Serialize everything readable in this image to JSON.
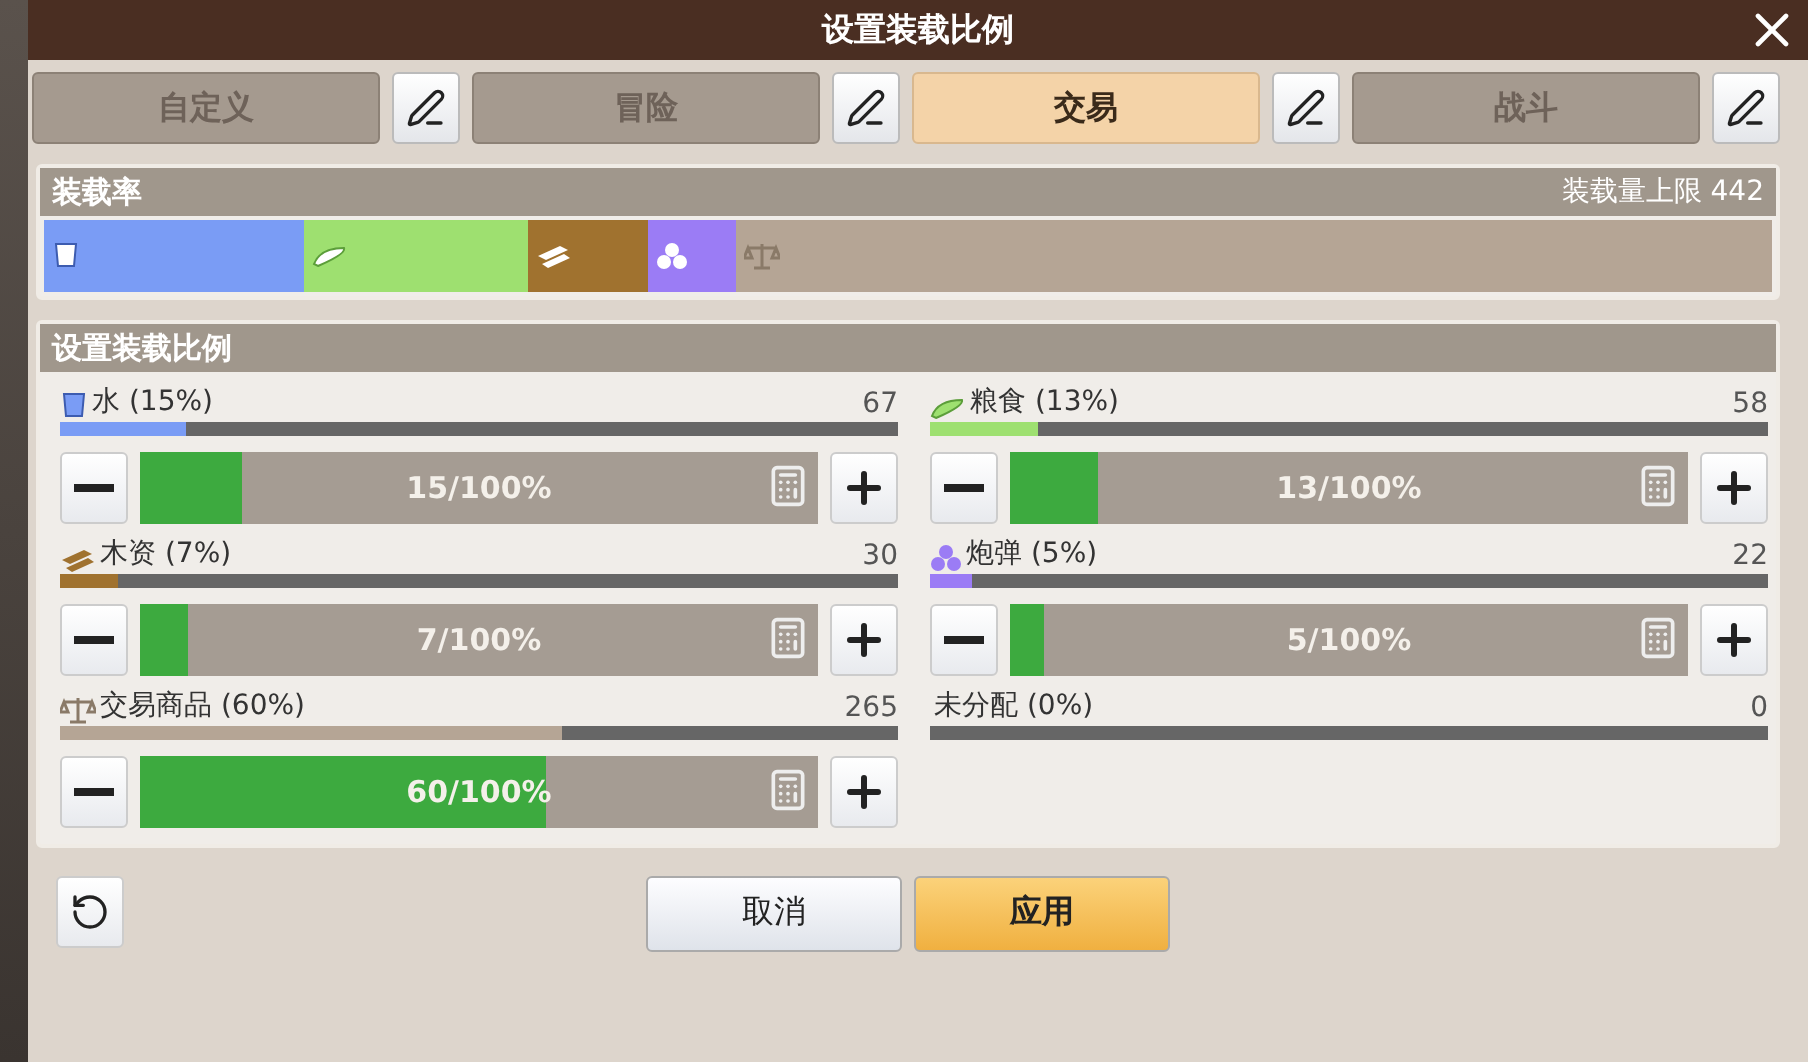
{
  "window": {
    "title": "设置装载比例"
  },
  "tabs": [
    {
      "label": "自定义",
      "selected": false
    },
    {
      "label": "冒险",
      "selected": false
    },
    {
      "label": "交易",
      "selected": true
    },
    {
      "label": "战斗",
      "selected": false
    }
  ],
  "load_panel": {
    "title": "装载率",
    "capacity": "装载量上限 442"
  },
  "ratio_panel": {
    "title": "设置装载比例"
  },
  "items": [
    {
      "kind": "water",
      "label": "水 (15%)",
      "amount": "67",
      "color": "#7a9cf5",
      "level": 0.15,
      "setting": "15/100%"
    },
    {
      "kind": "food",
      "label": "粮食 (13%)",
      "amount": "58",
      "color": "#9ee070",
      "level": 0.13,
      "setting": "13/100%"
    },
    {
      "kind": "wood",
      "label": "木资 (7%)",
      "amount": "30",
      "color": "#a0722f",
      "level": 0.07,
      "setting": "7/100%"
    },
    {
      "kind": "ammo",
      "label": "炮弹 (5%)",
      "amount": "22",
      "color": "#9b7cf5",
      "level": 0.05,
      "setting": "5/100%"
    },
    {
      "kind": "trade",
      "label": "交易商品 (60%)",
      "amount": "265",
      "color": "#b5a595",
      "level": 0.6,
      "setting": "60/100%"
    },
    {
      "kind": "unallocated",
      "label": "未分配 (0%)",
      "amount": "0",
      "color": "#555555",
      "level": 0
    }
  ],
  "buttons": [
    {
      "kind": "cancel",
      "label": "取消"
    },
    {
      "kind": "apply",
      "label": "应用"
    }
  ]
}
